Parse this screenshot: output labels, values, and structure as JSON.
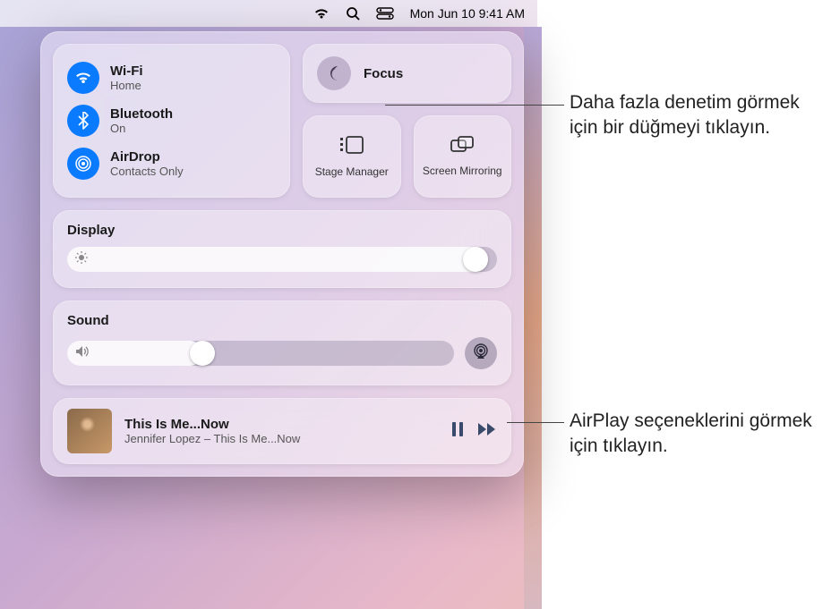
{
  "menubar": {
    "datetime": "Mon Jun 10  9:41 AM"
  },
  "connectivity": {
    "wifi": {
      "title": "Wi-Fi",
      "sub": "Home"
    },
    "bluetooth": {
      "title": "Bluetooth",
      "sub": "On"
    },
    "airdrop": {
      "title": "AirDrop",
      "sub": "Contacts Only"
    }
  },
  "focus": {
    "title": "Focus"
  },
  "stage_manager": {
    "label": "Stage Manager"
  },
  "screen_mirroring": {
    "label": "Screen Mirroring"
  },
  "display": {
    "title": "Display",
    "value_pct": 98
  },
  "sound": {
    "title": "Sound",
    "value_pct": 32
  },
  "now_playing": {
    "title": "This Is Me...Now",
    "artist_line": "Jennifer Lopez – This Is Me...Now"
  },
  "callouts": {
    "focus": "Daha fazla denetim görmek için bir düğmeyi tıklayın.",
    "airplay": "AirPlay seçeneklerini görmek için tıklayın."
  }
}
